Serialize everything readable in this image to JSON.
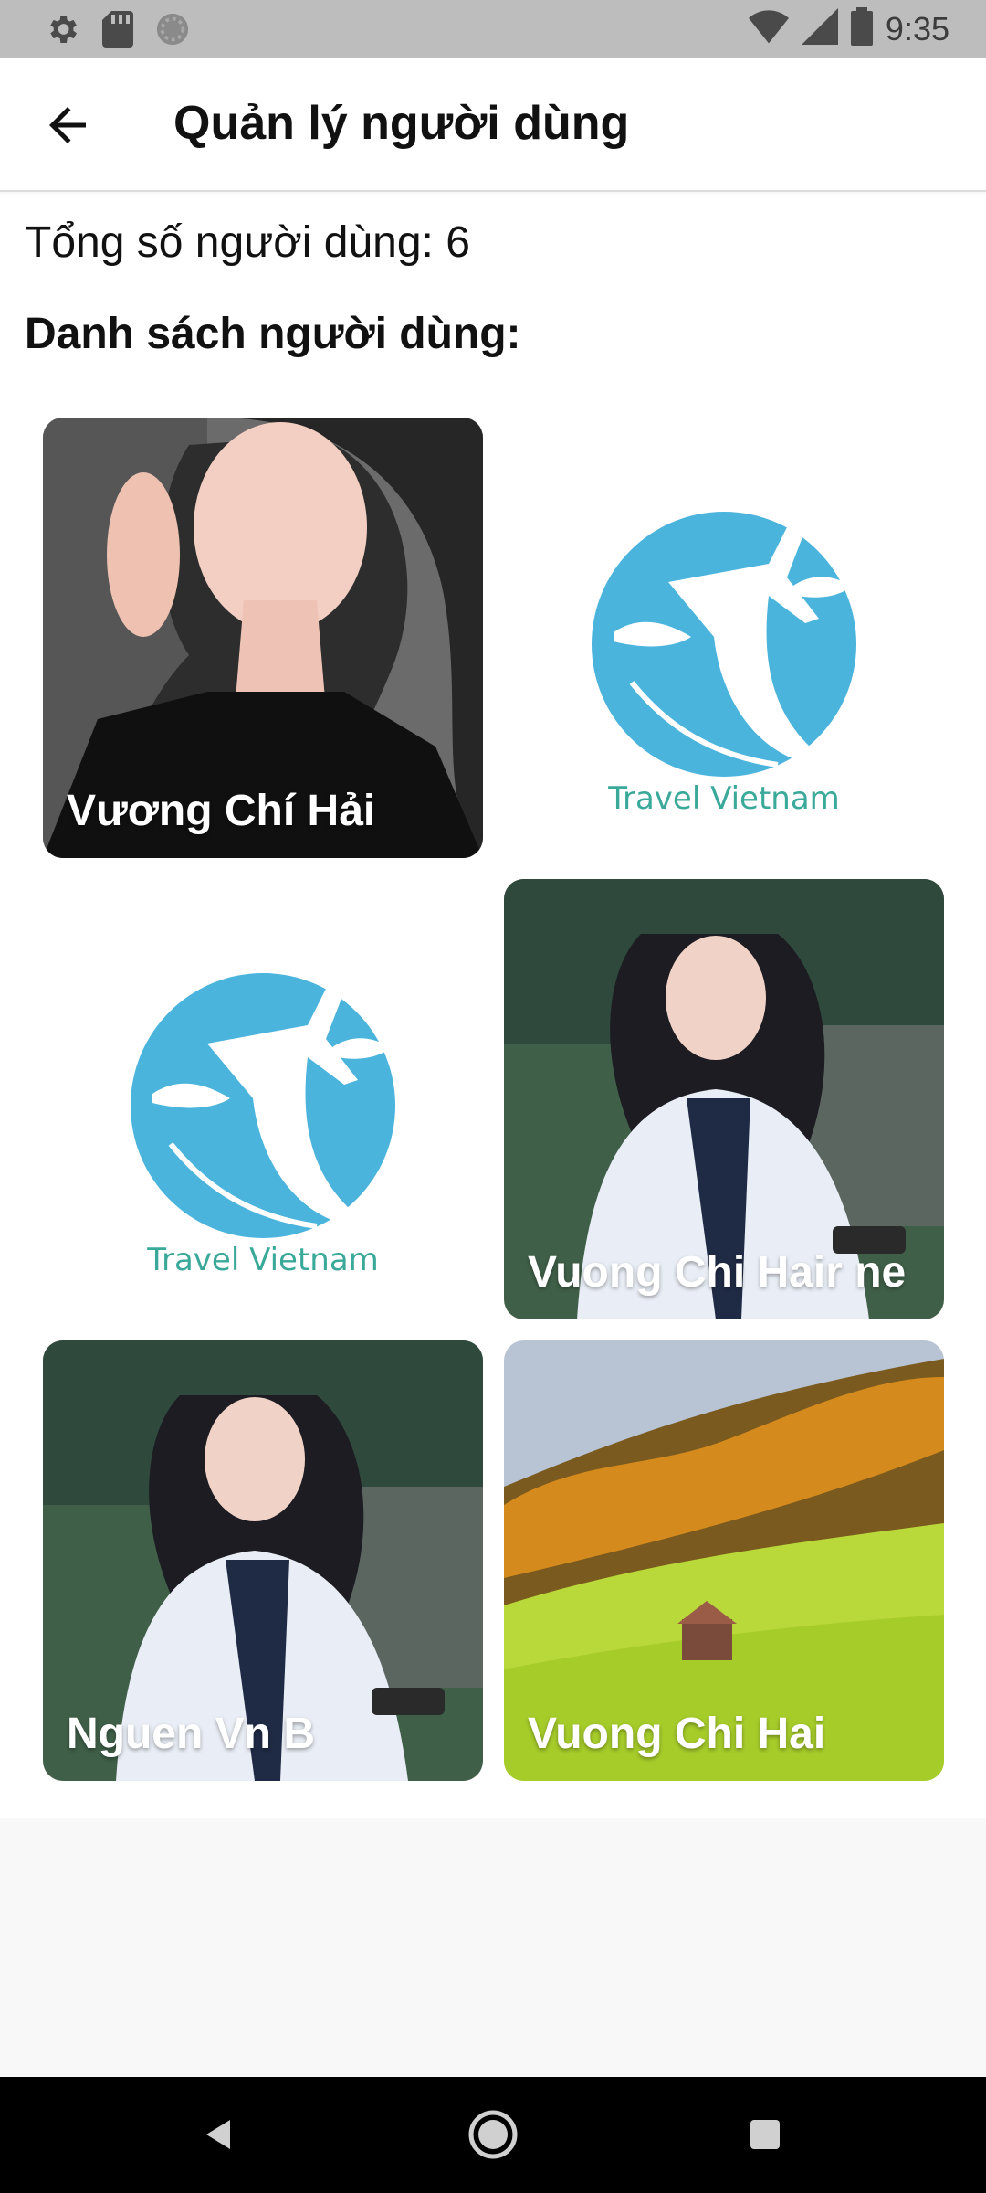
{
  "status_bar": {
    "time": "9:35",
    "left_icons": [
      "settings-icon",
      "sd-card-icon",
      "circle-icon"
    ],
    "right_icons": [
      "wifi-icon",
      "cell-signal-icon",
      "battery-icon"
    ]
  },
  "app_bar": {
    "title": "Quản lý người dùng",
    "back_icon": "arrow-back-icon"
  },
  "summary": {
    "total_label": "Tổng số người dùng: 6"
  },
  "list": {
    "heading": "Danh sách người dùng:",
    "users": [
      {
        "name": "Vương Chí Hải",
        "photo": "portrait"
      },
      {
        "name": "",
        "photo": "travel-vietnam-logo"
      },
      {
        "name": "",
        "photo": "travel-vietnam-logo"
      },
      {
        "name": "Vuong Chi Hair ne",
        "photo": "student-portrait"
      },
      {
        "name": "Nguen Vn B",
        "photo": "student-portrait"
      },
      {
        "name": "Vuong Chi Hai",
        "photo": "landscape"
      }
    ]
  },
  "logo_text": "Travel Vietnam",
  "colors": {
    "status_bar": "#bdbdbd",
    "app_bar": "#ffffff",
    "logo_blue": "#4ab4dc",
    "nav_bar": "#000000"
  },
  "nav_bar": {
    "icons": [
      "back-triangle-icon",
      "home-circle-icon",
      "recents-square-icon"
    ]
  }
}
